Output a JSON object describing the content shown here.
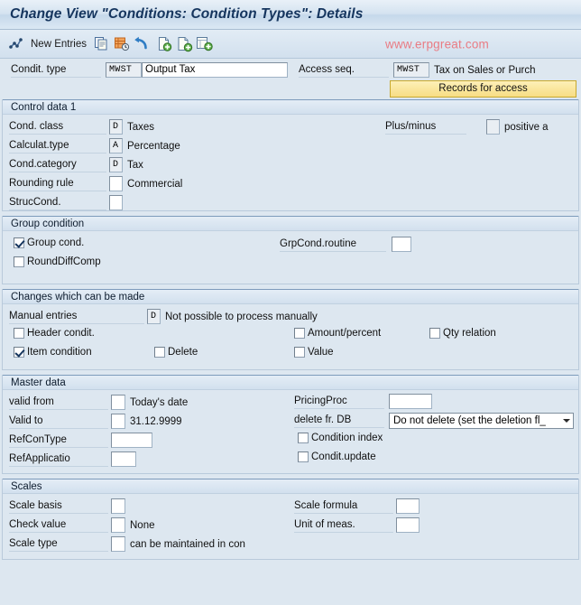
{
  "window": {
    "title": "Change View \"Conditions: Condition Types\": Details"
  },
  "toolbar": {
    "new_entries_label": "New Entries",
    "icons": [
      "new-entries-icon",
      "copy-icon",
      "delete-icon",
      "undo-icon",
      "previous-entry-icon",
      "next-entry-icon",
      "other-entry-icon"
    ],
    "watermark": "www.erpgreat.com"
  },
  "header": {
    "cond_type_label": "Condit. type",
    "cond_type_key": "MWST",
    "cond_type_text": "Output Tax",
    "access_seq_label": "Access seq.",
    "access_seq_key": "MWST",
    "access_seq_text": "Tax on Sales or Purch",
    "records_button": "Records for access"
  },
  "control_data": {
    "title": "Control data 1",
    "cond_class_label": "Cond. class",
    "cond_class_key": "D",
    "cond_class_text": "Taxes",
    "calc_type_label": "Calculat.type",
    "calc_type_key": "A",
    "calc_type_text": "Percentage",
    "cond_category_label": "Cond.category",
    "cond_category_key": "D",
    "cond_category_text": "Tax",
    "rounding_rule_label": "Rounding rule",
    "rounding_rule_key": "",
    "rounding_rule_text": "Commercial",
    "struc_cond_label": "StrucCond.",
    "struc_cond_key": "",
    "plus_minus_label": "Plus/minus",
    "plus_minus_key": "",
    "plus_minus_text": "positive a"
  },
  "group_condition": {
    "title": "Group condition",
    "group_cond_label": "Group cond.",
    "group_cond_checked": true,
    "round_diff_label": "RoundDiffComp",
    "round_diff_checked": false,
    "grpcond_routine_label": "GrpCond.routine",
    "grpcond_routine_value": ""
  },
  "changes": {
    "title": "Changes which can be made",
    "manual_entries_label": "Manual entries",
    "manual_entries_key": "D",
    "manual_entries_text": "Not possible to process manually",
    "header_cond_label": "Header condit.",
    "header_cond_checked": false,
    "item_cond_label": "Item condition",
    "item_cond_checked": true,
    "delete_label": "Delete",
    "delete_checked": false,
    "amount_percent_label": "Amount/percent",
    "amount_percent_checked": false,
    "value_label": "Value",
    "value_checked": false,
    "qty_relation_label": "Qty relation",
    "qty_relation_checked": false
  },
  "master_data": {
    "title": "Master data",
    "valid_from_label": "valid from",
    "valid_from_key": "",
    "valid_from_text": "Today's date",
    "valid_to_label": "Valid to",
    "valid_to_key": "",
    "valid_to_text": "31.12.9999",
    "ref_con_type_label": "RefConType",
    "ref_con_type_value": "",
    "ref_applicatio_label": "RefApplicatio",
    "ref_applicatio_value": "",
    "pricing_proc_label": "PricingProc",
    "pricing_proc_value": "",
    "delete_fr_db_label": "delete fr. DB",
    "delete_fr_db_value": "Do not delete (set the deletion fl_",
    "condition_index_label": "Condition index",
    "condition_index_checked": false,
    "condit_update_label": "Condit.update",
    "condit_update_checked": false
  },
  "scales": {
    "title": "Scales",
    "scale_basis_label": "Scale basis",
    "scale_basis_key": "",
    "check_value_label": "Check value",
    "check_value_key": "",
    "check_value_text": "None",
    "scale_type_label": "Scale type",
    "scale_type_key": "",
    "scale_type_text": "can be maintained in con",
    "scale_formula_label": "Scale formula",
    "scale_formula_value": "",
    "unit_of_meas_label": "Unit of meas.",
    "unit_of_meas_value": ""
  },
  "colors": {
    "accent": "#15355e",
    "background": "#dde7f0",
    "watermark": "#e97b83",
    "button_yellow": "#f7dd84"
  }
}
